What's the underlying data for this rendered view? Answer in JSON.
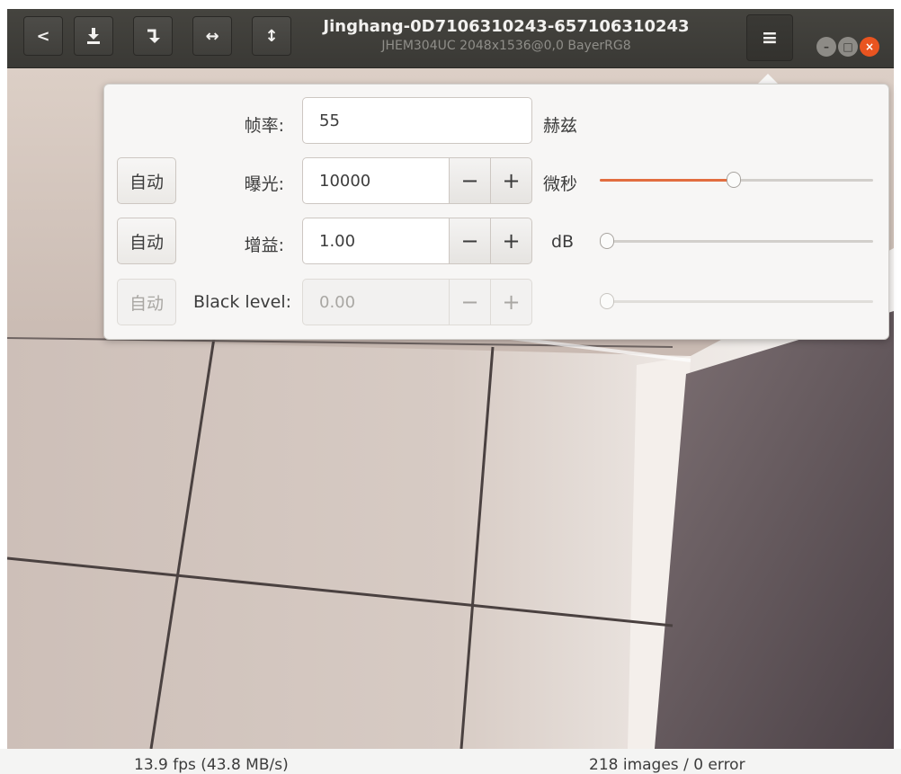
{
  "window": {
    "title": "Jinghang-0D7106310243-657106310243",
    "subtitle": "JHEM304UC 2048x1536@0,0 BayerRG8"
  },
  "toolbar": {
    "back_icon": "chevron-left-icon",
    "snapshot_icon": "download-icon",
    "rotate_icon": "rotate-arrow-icon",
    "flip_horizontal_icon": "horizontal-arrows-icon",
    "flip_vertical_icon": "vertical-arrows-icon",
    "menu_icon": "hamburger-menu-icon",
    "menu_glyph": "≡",
    "h_flip_glyph": "↔",
    "v_flip_glyph": "↕",
    "back_glyph": "<"
  },
  "window_controls": {
    "minimize_glyph": "–",
    "maximize_glyph": "□",
    "close_glyph": "×"
  },
  "settings": {
    "framerate": {
      "label": "帧率:",
      "value": "55",
      "unit": "赫兹"
    },
    "exposure": {
      "auto_label": "自动",
      "label": "曝光:",
      "value": "10000",
      "unit": "微秒",
      "minus": "−",
      "plus": "+",
      "slider_fraction": 0.49
    },
    "gain": {
      "auto_label": "自动",
      "label": "增益:",
      "value": "1.00",
      "unit": "dB",
      "minus": "−",
      "plus": "+",
      "slider_fraction": 0.0
    },
    "black_level": {
      "auto_label": "自动",
      "label": "Black level:",
      "value": "0.00",
      "minus": "−",
      "plus": "+",
      "slider_fraction": 0.0
    }
  },
  "colors": {
    "accent": "#e26d3f",
    "headerbar": "#3d3c38",
    "close_button": "#e95420"
  },
  "status": {
    "fps": "13.9 fps (43.8 MB/s)",
    "images": "218 images / 0 error"
  }
}
